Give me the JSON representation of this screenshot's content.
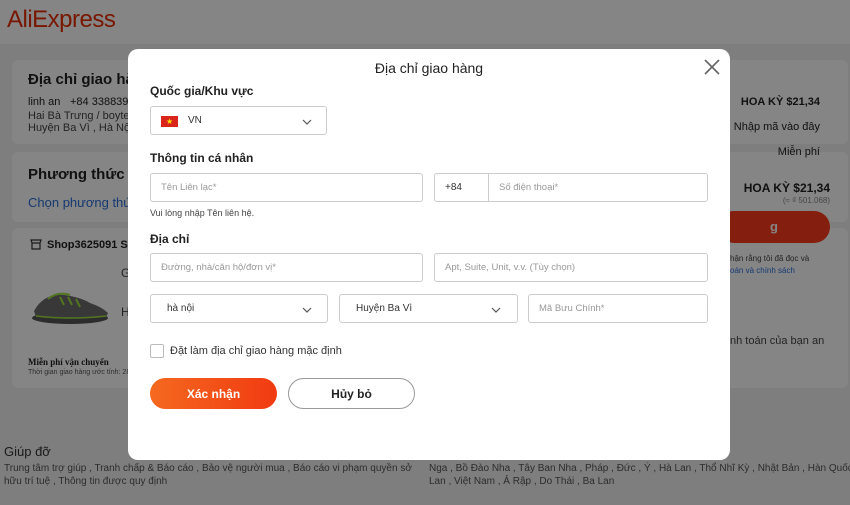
{
  "background": {
    "logo": "AliExpress",
    "address": {
      "heading": "Địa chỉ giao hàn",
      "name": "linh an",
      "phone": "+84 3388399",
      "line1": "Hai Bà Trưng / boyte",
      "line2": "Huyện Ba Vì , Hà Nội ,"
    },
    "payment": {
      "heading": "Phương thức th",
      "link": "Chọn phương thức"
    },
    "shop": {
      "name": "Shop3625091 Sto",
      "item_initial": "G",
      "item_initial2": "H",
      "shipping_free": "Miễn phí vận chuyển",
      "delivery_text": "Thời gian giao hàng ước tính: 28"
    },
    "summary": {
      "price1": "HOA KỲ $21,34",
      "coupon": "Nhập mã vào đây",
      "shipping": "Miễn phí",
      "total": "HOA KỲ $21,34",
      "total_sub": "(≈ ₫ 501.068)",
      "pay_button": "g",
      "agree1": "hận rằng tôi đã đọc và",
      "agree2": "oán và chính sách",
      "pay_note": "nh toán của bạn an"
    },
    "footer": {
      "help_title": "Giúp đỡ",
      "help_line1": "Trung tâm trợ giúp , Tranh chấp & Báo cáo , Bảo vệ người mua , Báo cáo vi phạm quyền sở",
      "help_line2": "hữu trí tuệ , Thông tin được quy định",
      "lang_line1": "Nga , Bồ Đào Nha , Tây Ban Nha , Pháp , Đức , Ý , Hà Lan , Thổ Nhĩ Kỳ , Nhật Bản , Hàn Quốc , Thái",
      "lang_line2": "Lan , Việt Nam , Ả Rập , Do Thái , Ba Lan"
    }
  },
  "modal": {
    "title": "Địa chỉ giao hàng",
    "country_label": "Quốc gia/Khu vực",
    "country_value": "VN",
    "personal_label": "Thông tin cá nhân",
    "contact_placeholder": "Tên Liên lạc*",
    "phone_prefix": "+84",
    "phone_placeholder": "Số điện thoại*",
    "contact_hint": "Vui lòng nhập Tên liên hệ.",
    "address_label": "Địa chỉ",
    "street_placeholder": "Đường, nhà/căn hộ/đơn vị*",
    "apt_placeholder": "Apt, Suite, Unit, v.v. (Tùy chọn)",
    "province_value": "hà nội",
    "district_value": "Huyện Ba Vì",
    "zip_placeholder": "Mã Bưu Chính*",
    "default_label": "Đặt làm địa chỉ giao hàng mặc định",
    "default_checked": false,
    "confirm_label": "Xác nhận",
    "cancel_label": "Hủy bỏ"
  },
  "colors": {
    "brand": "#e62e04",
    "confirm_start": "#f5691f",
    "confirm_end": "#f13a12",
    "link": "#2a6fdb"
  },
  "icons": [
    "close-icon",
    "chevron-down-icon",
    "vietnam-flag-icon",
    "shop-icon"
  ]
}
